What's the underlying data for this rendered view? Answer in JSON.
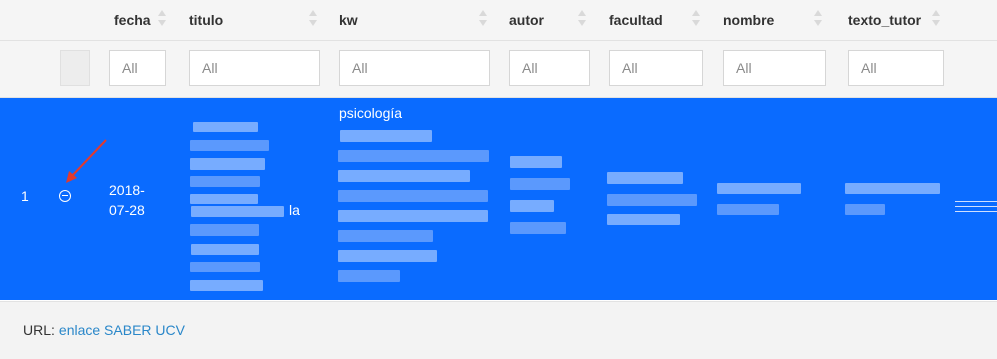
{
  "columns": [
    {
      "key": "fecha",
      "label": "fecha"
    },
    {
      "key": "titulo",
      "label": "titulo"
    },
    {
      "key": "kw",
      "label": "kw"
    },
    {
      "key": "autor",
      "label": "autor"
    },
    {
      "key": "facultad",
      "label": "facultad"
    },
    {
      "key": "nombre",
      "label": "nombre"
    },
    {
      "key": "texto_tutor",
      "label": "texto_tutor"
    }
  ],
  "filters": {
    "placeholder": "All"
  },
  "row": {
    "number": "1",
    "date": "2018-07-28",
    "kw_first_line": "psicología",
    "titulo_visible_word": "la",
    "selected_color": "#0a6bff"
  },
  "footer": {
    "url_label": "URL:",
    "url_link_text": "enlace SABER UCV"
  },
  "icons": {
    "row_toggle": "minus-circle-icon",
    "annotation": "red-arrow-icon",
    "sort": "sort-arrows-icon"
  }
}
